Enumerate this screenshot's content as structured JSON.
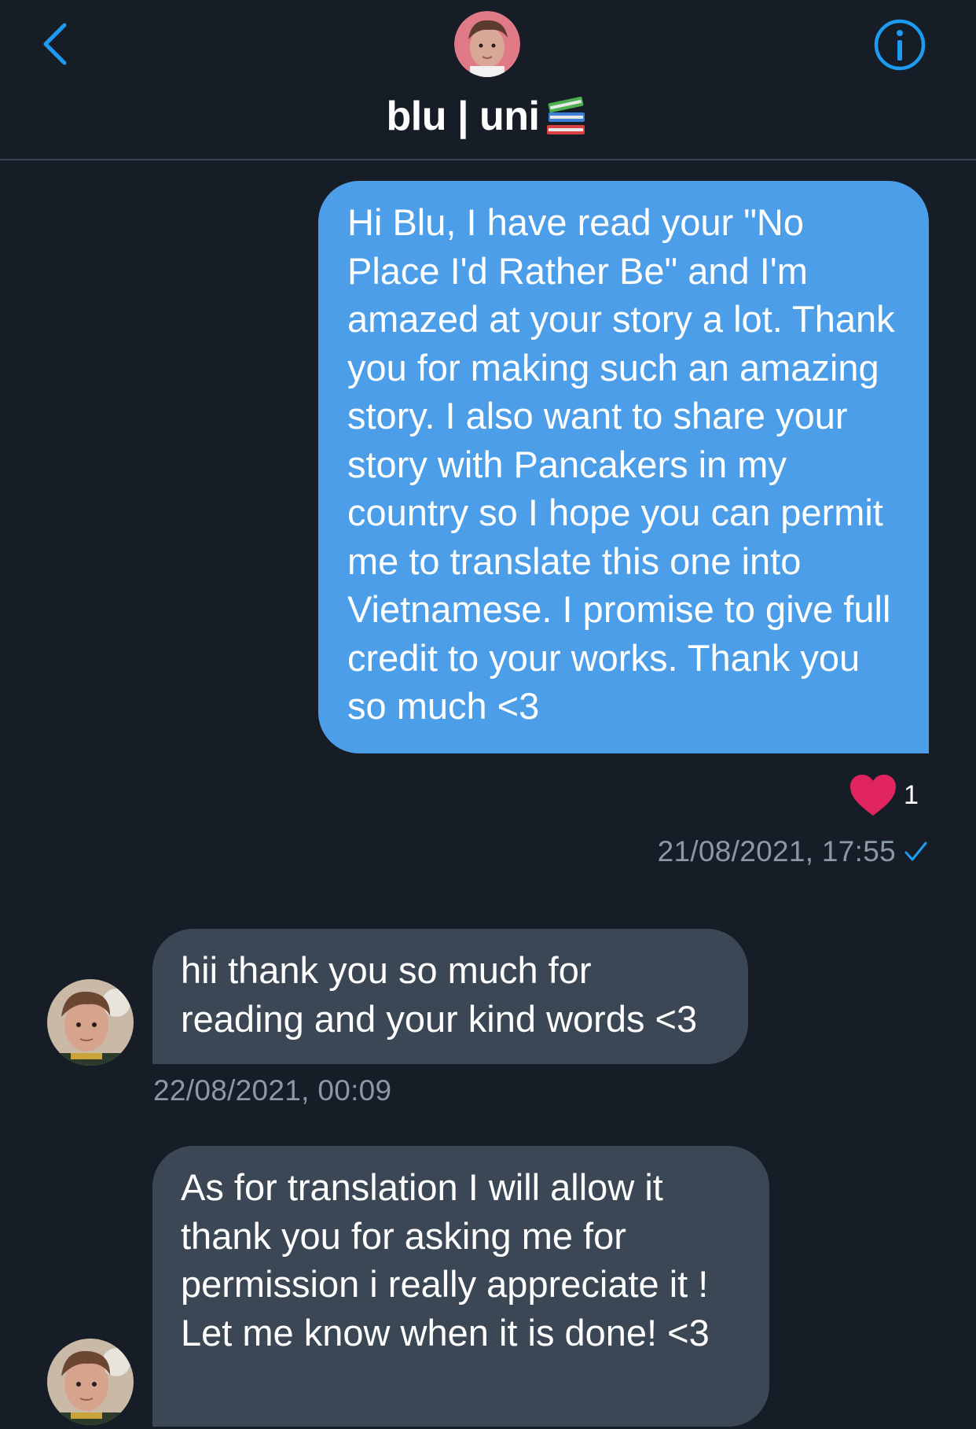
{
  "header": {
    "title": "blu | uni",
    "title_emoji": "books-icon",
    "back_icon": "chevron-left-icon",
    "info_icon": "info-icon"
  },
  "colors": {
    "background": "#161d27",
    "outgoing_bubble": "#4c9ee8",
    "incoming_bubble": "#3c4756",
    "accent": "#1d9bf0",
    "timestamp": "#8b98a5",
    "heart": "#e0245e"
  },
  "messages": [
    {
      "direction": "outgoing",
      "text": "Hi Blu, I have read your \"No Place I'd Rather Be\" and I'm amazed at your story a lot. Thank you for making such an amazing story. I also want to share your story with Pancakers in my country so I hope you can permit me to translate this one into Vietnamese. I promise to give full credit to your works. Thank you so much <3",
      "reaction": {
        "icon": "heart-icon",
        "count": "1"
      },
      "timestamp": "21/08/2021, 17:55",
      "status_icon": "checkmark-icon"
    },
    {
      "direction": "incoming",
      "text": "hii thank you so much for reading and your kind words <3",
      "timestamp": "22/08/2021, 00:09"
    },
    {
      "direction": "incoming",
      "text": "As for translation I will allow it thank you for asking me for permission i really appreciate it ! Let me know when it is done! <3"
    }
  ]
}
